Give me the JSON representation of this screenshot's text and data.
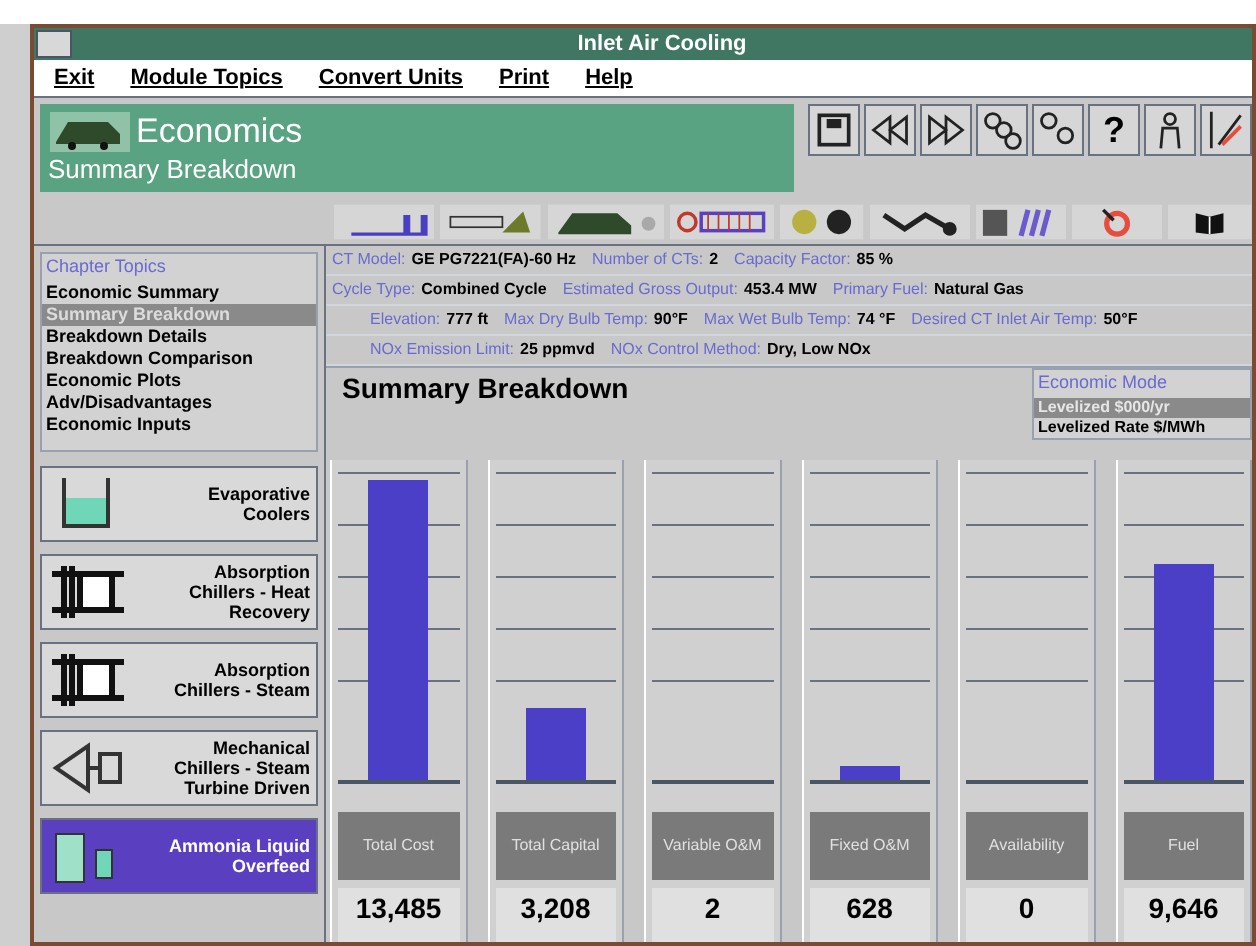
{
  "window": {
    "title": "Inlet Air Cooling"
  },
  "menu": [
    "Exit",
    "Module Topics",
    "Convert Units",
    "Print",
    "Help"
  ],
  "header": {
    "title": "Economics",
    "subtitle": "Summary Breakdown"
  },
  "nav_buttons": [
    {
      "kind": "floppy"
    },
    {
      "kind": "rewind"
    },
    {
      "kind": "forward"
    },
    {
      "kind": "links"
    },
    {
      "kind": "links2"
    },
    {
      "kind": "help",
      "label": "?"
    },
    {
      "kind": "person"
    },
    {
      "kind": "chart"
    }
  ],
  "chapter_topics": {
    "title": "Chapter Topics",
    "items": [
      {
        "label": "Economic Summary",
        "selected": false
      },
      {
        "label": "Summary Breakdown",
        "selected": true
      },
      {
        "label": "Breakdown Details",
        "selected": false
      },
      {
        "label": "Breakdown Comparison",
        "selected": false
      },
      {
        "label": "Economic Plots",
        "selected": false
      },
      {
        "label": "Adv/Disadvantages",
        "selected": false
      },
      {
        "label": "Economic Inputs",
        "selected": false
      }
    ]
  },
  "technologies": [
    {
      "kind": "tank",
      "label": "Evaporative Coolers",
      "selected": false
    },
    {
      "kind": "chiller",
      "label": "Absorption Chillers - Heat Recovery",
      "selected": false
    },
    {
      "kind": "chiller",
      "label": "Absorption Chillers - Steam",
      "selected": false
    },
    {
      "kind": "mechanical",
      "label": "Mechanical Chillers - Steam Turbine Driven",
      "selected": false
    },
    {
      "kind": "ammonia",
      "label": "Ammonia Liquid Overfeed",
      "selected": true
    }
  ],
  "info_rows": [
    [
      {
        "label": "CT Model:",
        "value": "GE PG7221(FA)-60 Hz"
      },
      {
        "label": "Number of CTs:",
        "value": "2"
      },
      {
        "label": "Capacity Factor:",
        "value": "85 %"
      }
    ],
    [
      {
        "label": "Cycle Type:",
        "value": "Combined Cycle"
      },
      {
        "label": "Estimated Gross Output:",
        "value": "453.4  MW"
      },
      {
        "label": "Primary Fuel:",
        "value": "Natural Gas"
      }
    ],
    [
      {
        "label": "Elevation:",
        "value": "777 ft"
      },
      {
        "label": "Max Dry Bulb Temp:",
        "value": "90°F"
      },
      {
        "label": "Max Wet Bulb Temp:",
        "value": "74 °F"
      },
      {
        "label": "Desired CT Inlet Air Temp:",
        "value": "50°F"
      }
    ],
    [
      {
        "label": "NOx Emission Limit:",
        "value": "25 ppmvd"
      },
      {
        "label": "NOx Control Method:",
        "value": "Dry, Low NOx"
      }
    ]
  ],
  "summary": {
    "title": "Summary Breakdown",
    "economic_mode": {
      "title": "Economic Mode",
      "options": [
        {
          "label": "Levelized $000/yr",
          "selected": true
        },
        {
          "label": "Levelized Rate $/MWh",
          "selected": false
        }
      ]
    },
    "columns": [
      {
        "label": "Total Cost",
        "value": "13,485",
        "level": 1.0
      },
      {
        "label": "Total Capital",
        "value": "3,208",
        "level": 0.24
      },
      {
        "label": "Variable O&M",
        "value": "2",
        "level": 0.0
      },
      {
        "label": "Fixed O&M",
        "value": "628",
        "level": 0.05
      },
      {
        "label": "Availability",
        "value": "0",
        "level": 0.0
      },
      {
        "label": "Fuel",
        "value": "9,646",
        "level": 0.72
      }
    ]
  }
}
